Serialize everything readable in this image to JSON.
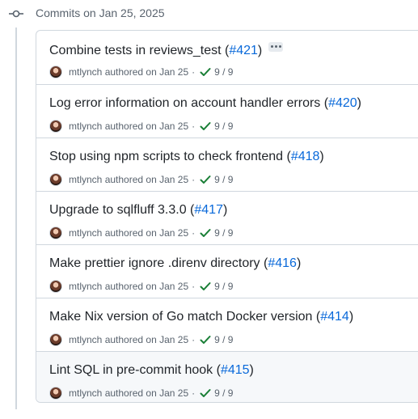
{
  "group": {
    "title": "Commits on Jan 25, 2025"
  },
  "commits": [
    {
      "title": "Combine tests in reviews_test",
      "pr": "#421",
      "author": "mtlynch",
      "action": "authored",
      "date": "on Jan 25",
      "checks": "9 / 9",
      "has_menu": true
    },
    {
      "title": "Log error information on account handler errors",
      "pr": "#420",
      "author": "mtlynch",
      "action": "authored",
      "date": "on Jan 25",
      "checks": "9 / 9"
    },
    {
      "title": "Stop using npm scripts to check frontend",
      "pr": "#418",
      "author": "mtlynch",
      "action": "authored",
      "date": "on Jan 25",
      "checks": "9 / 9"
    },
    {
      "title": "Upgrade to sqlfluff 3.3.0",
      "pr": "#417",
      "author": "mtlynch",
      "action": "authored",
      "date": "on Jan 25",
      "checks": "9 / 9"
    },
    {
      "title": "Make prettier ignore .direnv directory",
      "pr": "#416",
      "author": "mtlynch",
      "action": "authored",
      "date": "on Jan 25",
      "checks": "9 / 9"
    },
    {
      "title": "Make Nix version of Go match Docker version",
      "pr": "#414",
      "author": "mtlynch",
      "action": "authored",
      "date": "on Jan 25",
      "checks": "9 / 9"
    },
    {
      "title": "Lint SQL in pre-commit hook",
      "pr": "#415",
      "author": "mtlynch",
      "action": "authored",
      "date": "on Jan 25",
      "checks": "9 / 9"
    }
  ],
  "colors": {
    "link": "#0969da",
    "success": "#1a7f37",
    "muted": "#59636e",
    "border": "#d0d7de"
  }
}
